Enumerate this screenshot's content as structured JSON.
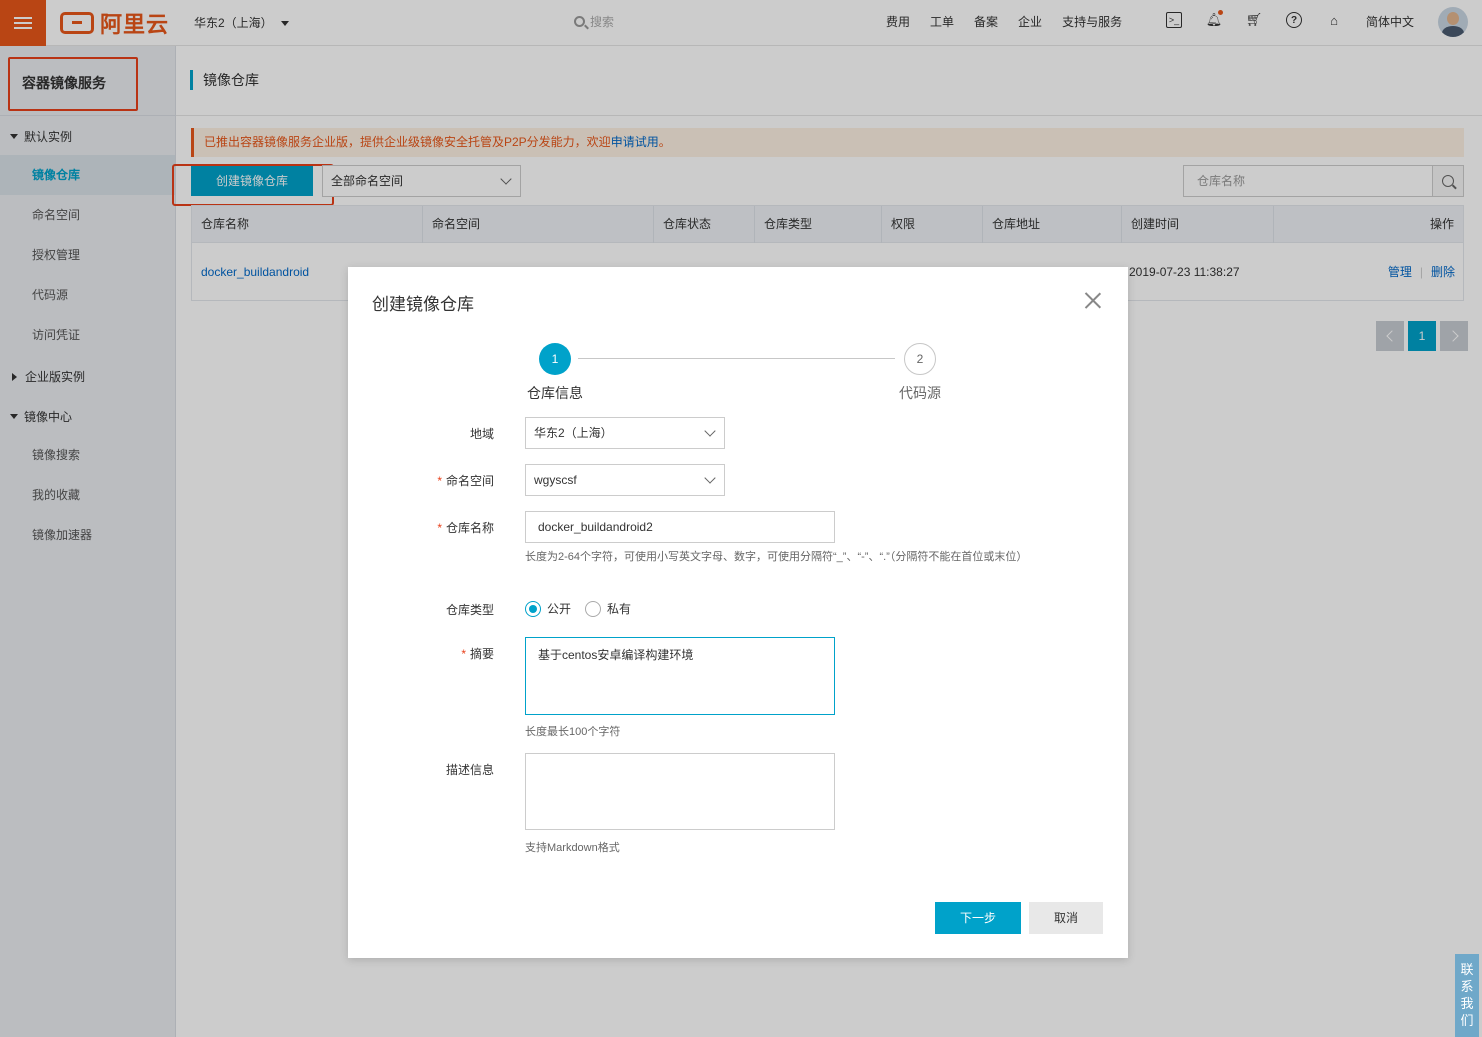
{
  "topbar": {
    "logo": "阿里云",
    "region": "华东2（上海）",
    "search_placeholder": "搜索",
    "links": [
      "费用",
      "工单",
      "备案",
      "企业",
      "支持与服务"
    ],
    "icons": [
      "terminal-icon",
      "bell-icon",
      "cart-icon",
      "help-icon",
      "home-icon"
    ],
    "language": "简体中文"
  },
  "sidebar": {
    "title": "容器镜像服务",
    "group_default": "默认实例",
    "items": [
      "镜像仓库",
      "命名空间",
      "授权管理",
      "代码源",
      "访问凭证"
    ],
    "group_enterprise": "企业版实例",
    "group_center": "镜像中心",
    "center_items": [
      "镜像搜索",
      "我的收藏",
      "镜像加速器"
    ]
  },
  "main": {
    "page_title": "镜像仓库",
    "notice_text": "已推出容器镜像服务企业版，提供企业级镜像安全托管及P2P分发能力，欢迎",
    "notice_link": "申请试用",
    "notice_end": "。",
    "create_button": "创建镜像仓库",
    "namespace_select": "全部命名空间",
    "search_placeholder": "仓库名称",
    "columns": [
      "仓库名称",
      "命名空间",
      "仓库状态",
      "仓库类型",
      "权限",
      "仓库地址",
      "创建时间",
      "操作"
    ],
    "row": {
      "name": "docker_buildandroid",
      "created": "2019-07-23 11:38:27",
      "op_manage": "管理",
      "op_delete": "删除"
    },
    "page_current": "1"
  },
  "dialog": {
    "title": "创建镜像仓库",
    "step1_num": "1",
    "step1_label": "仓库信息",
    "step2_num": "2",
    "step2_label": "代码源",
    "region_label": "地域",
    "region_value": "华东2（上海）",
    "namespace_label": "命名空间",
    "namespace_value": "wgyscsf",
    "name_label": "仓库名称",
    "name_value": "docker_buildandroid2",
    "name_hint": "长度为2-64个字符，可使用小写英文字母、数字，可使用分隔符“_”、“-”、“.”（分隔符不能在首位或末位）",
    "type_label": "仓库类型",
    "type_public": "公开",
    "type_private": "私有",
    "summary_label": "摘要",
    "summary_value": "基于centos安卓编译构建环境",
    "summary_hint": "长度最长100个字符",
    "desc_label": "描述信息",
    "desc_hint": "支持Markdown格式",
    "next_button": "下一步",
    "cancel_button": "取消"
  },
  "contact": "联系我们",
  "colors": {
    "accent": "#00a2ca",
    "brand": "#e8571a",
    "highlight": "#e8401a"
  }
}
